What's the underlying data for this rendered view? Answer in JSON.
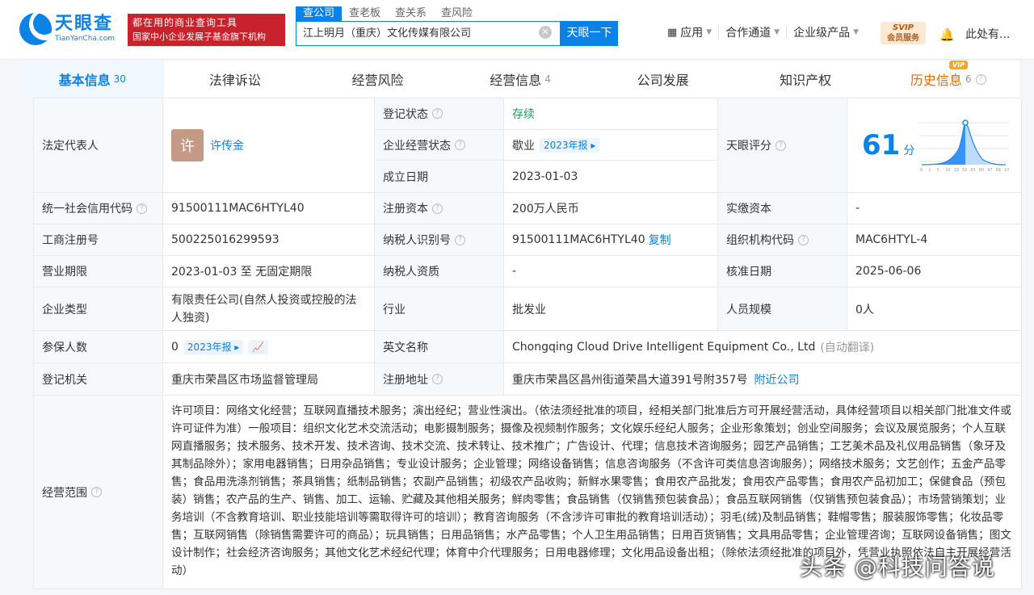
{
  "header": {
    "logo_cn": "天眼查",
    "logo_en": "TianYanCha.com",
    "slogan_line1": "都在用的商业查询工具",
    "slogan_line2": "国家中小企业发展子基金旗下机构",
    "search_tabs": [
      "查公司",
      "查老板",
      "查关系",
      "查风险"
    ],
    "search_value": "江上明月（重庆）文化传媒有限公司",
    "search_button": "天眼一下",
    "nav": [
      "应用",
      "合作通道",
      "企业级产品"
    ],
    "svip_line1": "SVIP",
    "svip_line2": "会员服务",
    "user": "此处有..."
  },
  "tabs": [
    {
      "label": "基本信息",
      "count": "30"
    },
    {
      "label": "法律诉讼",
      "count": ""
    },
    {
      "label": "经营风险",
      "count": ""
    },
    {
      "label": "经营信息",
      "count": "4"
    },
    {
      "label": "公司发展",
      "count": ""
    },
    {
      "label": "知识产权",
      "count": ""
    },
    {
      "label": "历史信息",
      "count": "6"
    }
  ],
  "vip_tag": "VIP",
  "info": {
    "legal_rep_label": "法定代表人",
    "legal_rep_avatar": "许",
    "legal_rep_name": "许传金",
    "reg_status_label": "登记状态",
    "reg_status_value": "存续",
    "op_status_label": "企业经营状态",
    "op_status_value": "歇业",
    "report_badge": "2023年报",
    "est_date_label": "成立日期",
    "est_date_value": "2023-01-03",
    "score_label": "天眼评分",
    "score_value": "61",
    "score_unit": "分",
    "score_axis": [
      "0",
      "1",
      "5",
      "10",
      "20",
      "50",
      "65",
      "80",
      "97",
      "99",
      "100"
    ],
    "credit_code_label": "统一社会信用代码",
    "credit_code_value": "91500111MAC6HTYL40",
    "reg_capital_label": "注册资本",
    "reg_capital_value": "200万人民币",
    "paid_capital_label": "实缴资本",
    "paid_capital_value": "-",
    "biz_reg_no_label": "工商注册号",
    "biz_reg_no_value": "500225016299593",
    "taxpayer_id_label": "纳税人识别号",
    "taxpayer_id_value": "91500111MAC6HTYL40",
    "copy_label": "复制",
    "org_code_label": "组织机构代码",
    "org_code_value": "MAC6HTYL-4",
    "term_label": "营业期限",
    "term_value": "2023-01-03 至 无固定期限",
    "taxpayer_qual_label": "纳税人资质",
    "taxpayer_qual_value": "-",
    "approve_date_label": "核准日期",
    "approve_date_value": "2025-06-06",
    "company_type_label": "企业类型",
    "company_type_value": "有限责任公司(自然人投资或控股的法人独资)",
    "industry_label": "行业",
    "industry_value": "批发业",
    "staff_size_label": "人员规模",
    "staff_size_value": "0人",
    "insured_label": "参保人数",
    "insured_value": "0",
    "english_name_label": "英文名称",
    "english_name_value": "Chongqing Cloud Drive Intelligent Equipment Co., Ltd",
    "auto_translate": "(自动翻译)",
    "reg_authority_label": "登记机关",
    "reg_authority_value": "重庆市荣昌区市场监督管理局",
    "reg_address_label": "注册地址",
    "reg_address_value": "重庆市荣昌区昌州街道荣昌大道391号附357号",
    "nearby_label": "附近公司",
    "scope_label": "经营范围",
    "scope_value": "许可项目：网络文化经营；互联网直播技术服务；演出经纪；营业性演出。（依法须经批准的项目，经相关部门批准后方可开展经营活动，具体经营项目以相关部门批准文件或许可证件为准）一般项目：组织文化艺术交流活动；电影摄制服务；摄像及视频制作服务；文化娱乐经纪人服务；企业形象策划；创业空间服务；会议及展览服务；个人互联网直播服务；技术服务、技术开发、技术咨询、技术交流、技术转让、技术推广；广告设计、代理；信息技术咨询服务；园艺产品销售；工艺美术品及礼仪用品销售（象牙及其制品除外）；家用电器销售；日用杂品销售；专业设计服务；企业管理；网络设备销售；信息咨询服务（不含许可类信息咨询服务）；网络技术服务；文艺创作；五金产品零售；食品用洗涤剂销售；茶具销售；纸制品销售；农副产品销售；初级农产品收购；新鲜水果零售；食用农产品批发；食用农产品零售；食用农产品初加工；保健食品（预包装）销售；农产品的生产、销售、加工、运输、贮藏及其他相关服务；鲜肉零售；食品销售（仅销售预包装食品）；食品互联网销售（仅销售预包装食品）；市场营销策划；业务培训（不含教育培训、职业技能培训等需取得许可的培训）；教育咨询服务（不含涉许可审批的教育培训活动）；羽毛(绒)及制品销售；鞋帽零售；服装服饰零售；化妆品零售；互联网销售（除销售需要许可的商品）；玩具销售；日用品销售；水产品零售；个人卫生用品销售；日用百货销售；文具用品零售；企业管理咨询；互联网设备销售；图文设计制作；社会经济咨询服务；其他文化艺术经纪代理；体育中介代理服务；日用电器修理；文化用品设备出租；（除依法须经批准的项目外，凭营业执照依法自主开展经营活动）"
  },
  "watermark": "头条 @科技问答说",
  "colors": {
    "accent": "#0a82e6",
    "slogan_bg": "#c8232c",
    "status_green": "#1aa05a",
    "history_orange": "#e26a00"
  }
}
